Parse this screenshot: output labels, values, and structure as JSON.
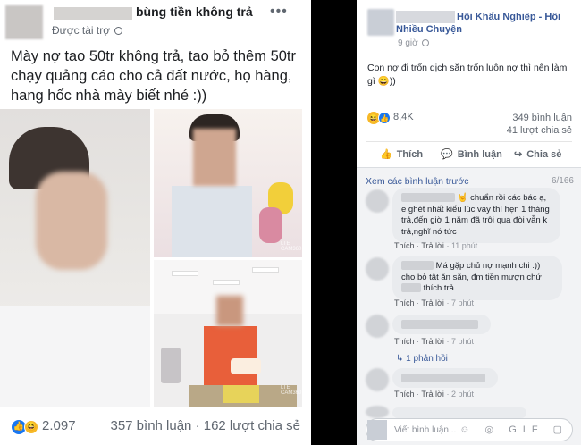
{
  "left_post": {
    "page_name": "bùng tiền không trả",
    "sponsored": "Được tài trợ",
    "more": "•••",
    "text": "Mày nợ tao 50tr không trả, tao bỏ thêm 50tr chạy quảng cáo cho cả đất nước, họ hàng, hang hốc nhà mày biết nhé :))",
    "reaction_count": "2.097",
    "stats": "357 bình luận · 162 lượt chia sẻ",
    "watermark": "LTE\nCAMERA360"
  },
  "right_post": {
    "group_name": "Hội Khẩu Nghiệp - Hội",
    "group_name_2": "Nhiều Chuyện",
    "time": "9 giờ",
    "text": "Con nợ đi trốn dịch sẵn trốn luôn nợ thì nên làm gì 😀))",
    "reaction_count": "8,4K",
    "comments_count": "349 bình luận",
    "shares_count": "41 lượt chia sẻ",
    "actions": {
      "like": "Thích",
      "comment": "Bình luận",
      "share": "Chia sẻ"
    },
    "view_previous": "Xem các bình luận trước",
    "pager": "6/166",
    "comments": [
      {
        "text_pre": "🤘 chuẩn rồi các bác ạ, e ghét nhất kiểu lúc vay thì hẹn 1 tháng trả,đến giờ 1 năm đã trôi qua đòi vẫn k trả,nghĩ nó tức",
        "like": "Thích",
        "reply": "Trả lời",
        "time": "11 phút"
      },
      {
        "text_pre": "Má gặp chủ nợ mạnh chi :)) cho bỏ tật ăn sẵn, đm tiền mượn chứ",
        "text_post": "thích trả",
        "like": "Thích",
        "reply": "Trả lời",
        "time": "7 phút"
      },
      {
        "like": "Thích",
        "reply": "Trả lời",
        "time": "7 phút"
      },
      {
        "like": "Thích",
        "reply": "Trả lời",
        "time": "2 phút"
      }
    ],
    "replies": "1 phản hồi",
    "input_placeholder": "Viết bình luận...",
    "input_icons": "☺ ◎ GIF ▢"
  }
}
